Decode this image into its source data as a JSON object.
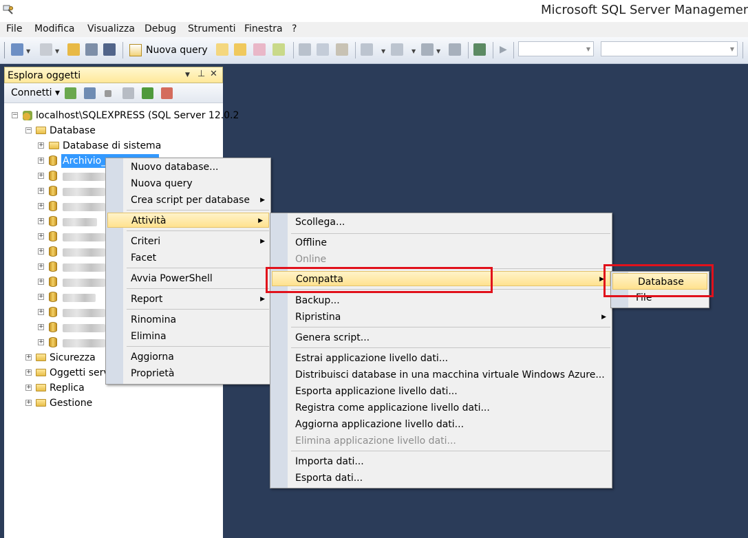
{
  "window": {
    "title": "Microsoft SQL Server Management S"
  },
  "menubar": {
    "items": [
      "File",
      "Modifica",
      "Visualizza",
      "Debug",
      "Strumenti",
      "Finestra",
      "?"
    ]
  },
  "toolbar": {
    "new_query_label": "Nuova query"
  },
  "object_explorer": {
    "title": "Esplora oggetti",
    "pin_label": "▾ 📌 ✕",
    "connect_label": "Connetti ▾",
    "server_node": "localhost\\SQLEXPRESS (SQL Server 12.0.2",
    "databases_label": "Database",
    "system_db_label": "Database di sistema",
    "selected_db_label": "Archivio_",
    "other_folders": [
      "Sicurezza",
      "Oggetti serv",
      "Replica",
      "Gestione"
    ]
  },
  "context_menu": {
    "items": [
      "Nuovo database...",
      "Nuova query",
      "Crea script per database",
      "Attività",
      "Criteri",
      "Facet",
      "Avvia PowerShell",
      "Report",
      "Rinomina",
      "Elimina",
      "Aggiorna",
      "Proprietà"
    ]
  },
  "tasks_menu": {
    "items": [
      "Scollega...",
      "Offline",
      "Online",
      "Compatta",
      "Backup...",
      "Ripristina",
      "Genera script...",
      "Estrai applicazione livello dati...",
      "Distribuisci database in una macchina virtuale Windows Azure...",
      "Esporta applicazione livello dati...",
      "Registra come applicazione livello dati...",
      "Aggiorna applicazione livello dati...",
      "Elimina applicazione livello dati...",
      "Importa dati...",
      "Esporta dati..."
    ]
  },
  "shrink_menu": {
    "items": [
      "Database",
      "File"
    ]
  },
  "colors": {
    "accent_red": "#e1111b",
    "highlight": "#ffe28f",
    "selection": "#3399ff"
  }
}
